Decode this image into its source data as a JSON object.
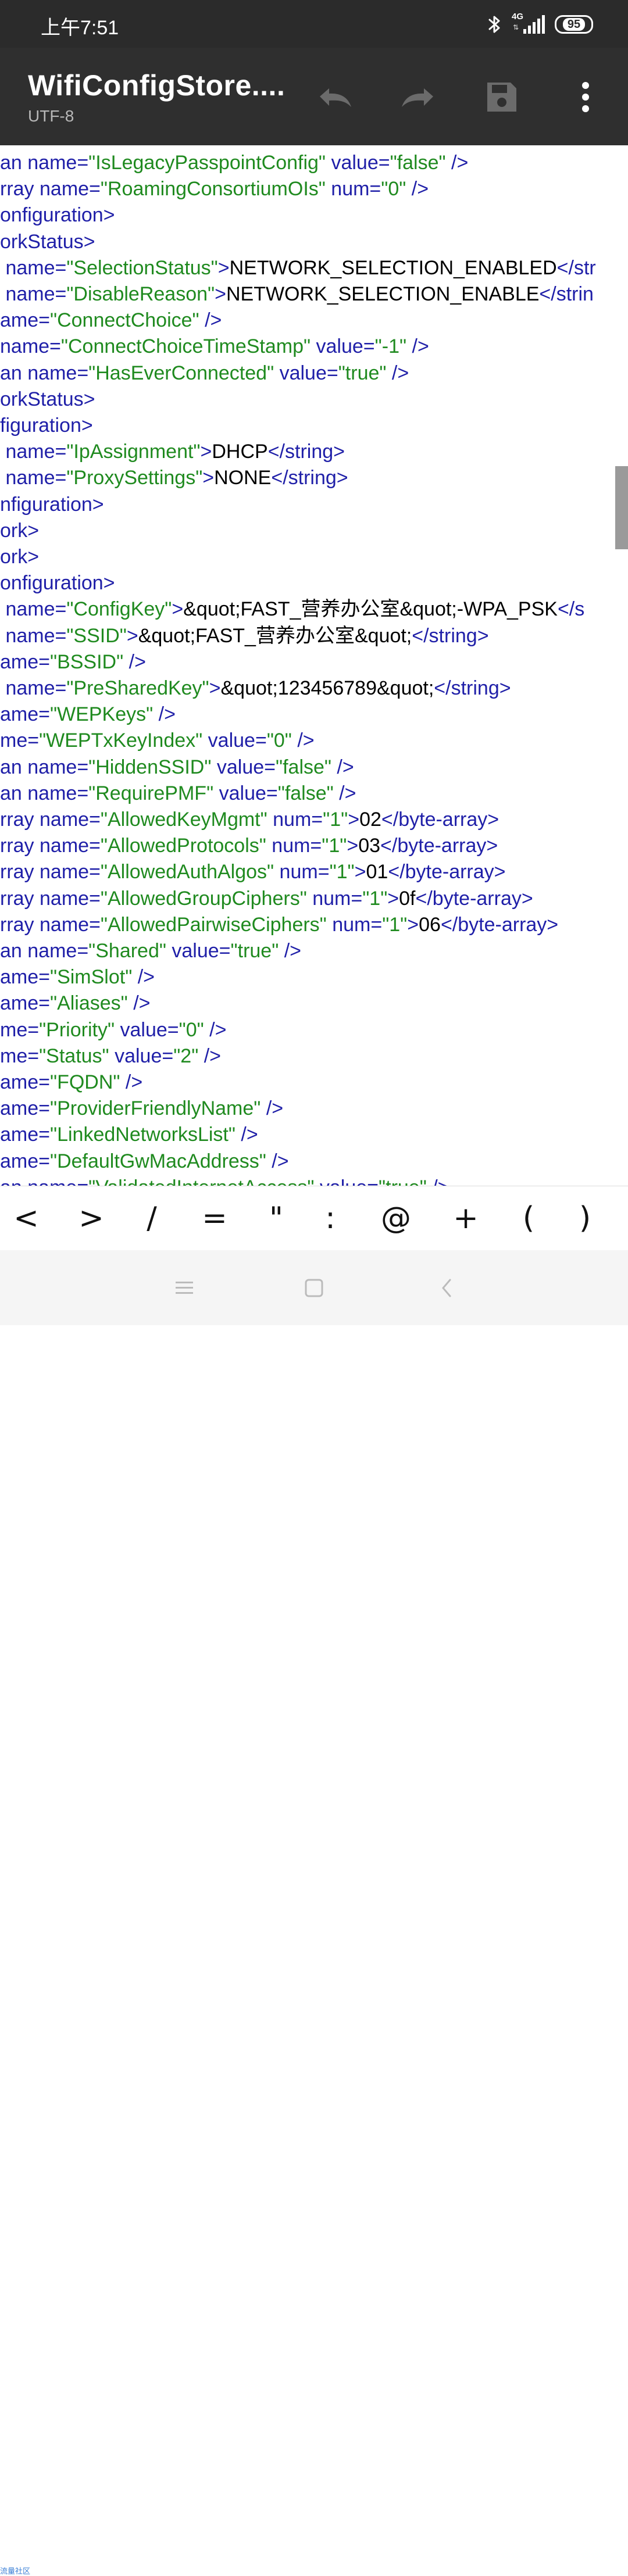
{
  "status_bar": {
    "time": "上午7:51",
    "network_label": "4G",
    "battery": "95",
    "icons": [
      "bluetooth-icon",
      "signal-icon",
      "battery-icon"
    ]
  },
  "app_bar": {
    "title": "WifiConfigStore....",
    "encoding": "UTF-8",
    "actions": [
      "undo-icon",
      "redo-icon",
      "save-icon",
      "more-vert-icon"
    ]
  },
  "colors": {
    "attr": "#1f1fa8",
    "value": "#1f8a1f",
    "text": "#000000",
    "app_bar": "#2f2f2f"
  },
  "editor": {
    "lines": [
      [
        [
          "attr",
          "an name="
        ],
        [
          "val",
          "\"IsLegacyPasspointConfig\""
        ],
        [
          "attr",
          " value="
        ],
        [
          "val",
          "\"false\""
        ],
        [
          "attr",
          " />"
        ]
      ],
      [
        [
          "attr",
          "rray name="
        ],
        [
          "val",
          "\"RoamingConsortiumOIs\""
        ],
        [
          "attr",
          " num="
        ],
        [
          "val",
          "\"0\""
        ],
        [
          "attr",
          " />"
        ]
      ],
      [
        [
          "attr",
          "onfiguration>"
        ]
      ],
      [
        [
          "attr",
          "orkStatus>"
        ]
      ],
      [
        [
          "attr",
          " name="
        ],
        [
          "val",
          "\"SelectionStatus\""
        ],
        [
          "attr",
          ">"
        ],
        [
          "txt",
          "NETWORK_SELECTION_ENABLED"
        ],
        [
          "attr",
          "</str"
        ]
      ],
      [
        [
          "attr",
          " name="
        ],
        [
          "val",
          "\"DisableReason\""
        ],
        [
          "attr",
          ">"
        ],
        [
          "txt",
          "NETWORK_SELECTION_ENABLE"
        ],
        [
          "attr",
          "</strin"
        ]
      ],
      [
        [
          "attr",
          "ame="
        ],
        [
          "val",
          "\"ConnectChoice\""
        ],
        [
          "attr",
          " />"
        ]
      ],
      [
        [
          "attr",
          "name="
        ],
        [
          "val",
          "\"ConnectChoiceTimeStamp\""
        ],
        [
          "attr",
          " value="
        ],
        [
          "val",
          "\"-1\""
        ],
        [
          "attr",
          " />"
        ]
      ],
      [
        [
          "attr",
          "an name="
        ],
        [
          "val",
          "\"HasEverConnected\""
        ],
        [
          "attr",
          " value="
        ],
        [
          "val",
          "\"true\""
        ],
        [
          "attr",
          " />"
        ]
      ],
      [
        [
          "attr",
          "orkStatus>"
        ]
      ],
      [
        [
          "attr",
          "figuration>"
        ]
      ],
      [
        [
          "attr",
          " name="
        ],
        [
          "val",
          "\"IpAssignment\""
        ],
        [
          "attr",
          ">"
        ],
        [
          "txt",
          "DHCP"
        ],
        [
          "attr",
          "</string>"
        ]
      ],
      [
        [
          "attr",
          " name="
        ],
        [
          "val",
          "\"ProxySettings\""
        ],
        [
          "attr",
          ">"
        ],
        [
          "txt",
          "NONE"
        ],
        [
          "attr",
          "</string>"
        ]
      ],
      [
        [
          "attr",
          "nfiguration>"
        ]
      ],
      [
        [
          "attr",
          "ork>"
        ]
      ],
      [
        [
          "attr",
          "ork>"
        ]
      ],
      [
        [
          "attr",
          "onfiguration>"
        ]
      ],
      [
        [
          "attr",
          " name="
        ],
        [
          "val",
          "\"ConfigKey\""
        ],
        [
          "attr",
          ">"
        ],
        [
          "txt",
          "&quot;FAST_营养办公室&quot;-WPA_PSK"
        ],
        [
          "attr",
          "</s"
        ]
      ],
      [
        [
          "attr",
          " name="
        ],
        [
          "val",
          "\"SSID\""
        ],
        [
          "attr",
          ">"
        ],
        [
          "txt",
          "&quot;FAST_营养办公室&quot;"
        ],
        [
          "attr",
          "</string>"
        ]
      ],
      [
        [
          "attr",
          "ame="
        ],
        [
          "val",
          "\"BSSID\""
        ],
        [
          "attr",
          " />"
        ]
      ],
      [
        [
          "attr",
          " name="
        ],
        [
          "val",
          "\"PreSharedKey\""
        ],
        [
          "attr",
          ">"
        ],
        [
          "txt",
          "&quot;123456789&quot;"
        ],
        [
          "attr",
          "</string>"
        ]
      ],
      [
        [
          "attr",
          "ame="
        ],
        [
          "val",
          "\"WEPKeys\""
        ],
        [
          "attr",
          " />"
        ]
      ],
      [
        [
          "attr",
          "me="
        ],
        [
          "val",
          "\"WEPTxKeyIndex\""
        ],
        [
          "attr",
          " value="
        ],
        [
          "val",
          "\"0\""
        ],
        [
          "attr",
          " />"
        ]
      ],
      [
        [
          "attr",
          "an name="
        ],
        [
          "val",
          "\"HiddenSSID\""
        ],
        [
          "attr",
          " value="
        ],
        [
          "val",
          "\"false\""
        ],
        [
          "attr",
          " />"
        ]
      ],
      [
        [
          "attr",
          "an name="
        ],
        [
          "val",
          "\"RequirePMF\""
        ],
        [
          "attr",
          " value="
        ],
        [
          "val",
          "\"false\""
        ],
        [
          "attr",
          " />"
        ]
      ],
      [
        [
          "attr",
          "rray name="
        ],
        [
          "val",
          "\"AllowedKeyMgmt\""
        ],
        [
          "attr",
          " num="
        ],
        [
          "val",
          "\"1\""
        ],
        [
          "attr",
          ">"
        ],
        [
          "txt",
          "02"
        ],
        [
          "attr",
          "</byte-array>"
        ]
      ],
      [
        [
          "attr",
          "rray name="
        ],
        [
          "val",
          "\"AllowedProtocols\""
        ],
        [
          "attr",
          " num="
        ],
        [
          "val",
          "\"1\""
        ],
        [
          "attr",
          ">"
        ],
        [
          "txt",
          "03"
        ],
        [
          "attr",
          "</byte-array>"
        ]
      ],
      [
        [
          "attr",
          "rray name="
        ],
        [
          "val",
          "\"AllowedAuthAlgos\""
        ],
        [
          "attr",
          " num="
        ],
        [
          "val",
          "\"1\""
        ],
        [
          "attr",
          ">"
        ],
        [
          "txt",
          "01"
        ],
        [
          "attr",
          "</byte-array>"
        ]
      ],
      [
        [
          "attr",
          "rray name="
        ],
        [
          "val",
          "\"AllowedGroupCiphers\""
        ],
        [
          "attr",
          " num="
        ],
        [
          "val",
          "\"1\""
        ],
        [
          "attr",
          ">"
        ],
        [
          "txt",
          "0f"
        ],
        [
          "attr",
          "</byte-array>"
        ]
      ],
      [
        [
          "attr",
          "rray name="
        ],
        [
          "val",
          "\"AllowedPairwiseCiphers\""
        ],
        [
          "attr",
          " num="
        ],
        [
          "val",
          "\"1\""
        ],
        [
          "attr",
          ">"
        ],
        [
          "txt",
          "06"
        ],
        [
          "attr",
          "</byte-array>"
        ]
      ],
      [
        [
          "attr",
          "an name="
        ],
        [
          "val",
          "\"Shared\""
        ],
        [
          "attr",
          " value="
        ],
        [
          "val",
          "\"true\""
        ],
        [
          "attr",
          " />"
        ]
      ],
      [
        [
          "attr",
          "ame="
        ],
        [
          "val",
          "\"SimSlot\""
        ],
        [
          "attr",
          " />"
        ]
      ],
      [
        [
          "attr",
          "ame="
        ],
        [
          "val",
          "\"Aliases\""
        ],
        [
          "attr",
          " />"
        ]
      ],
      [
        [
          "attr",
          "me="
        ],
        [
          "val",
          "\"Priority\""
        ],
        [
          "attr",
          " value="
        ],
        [
          "val",
          "\"0\""
        ],
        [
          "attr",
          " />"
        ]
      ],
      [
        [
          "attr",
          "me="
        ],
        [
          "val",
          "\"Status\""
        ],
        [
          "attr",
          " value="
        ],
        [
          "val",
          "\"2\""
        ],
        [
          "attr",
          " />"
        ]
      ],
      [
        [
          "attr",
          "ame="
        ],
        [
          "val",
          "\"FQDN\""
        ],
        [
          "attr",
          " />"
        ]
      ],
      [
        [
          "attr",
          "ame="
        ],
        [
          "val",
          "\"ProviderFriendlyName\""
        ],
        [
          "attr",
          " />"
        ]
      ],
      [
        [
          "attr",
          "ame="
        ],
        [
          "val",
          "\"LinkedNetworksList\""
        ],
        [
          "attr",
          " />"
        ]
      ],
      [
        [
          "attr",
          "ame="
        ],
        [
          "val",
          "\"DefaultGwMacAddress\""
        ],
        [
          "attr",
          " />"
        ]
      ],
      [
        [
          "attr",
          "an name="
        ],
        [
          "val",
          "\"ValidatedInternetAccess\""
        ],
        [
          "attr",
          " value="
        ],
        [
          "val",
          "\"true\""
        ],
        [
          "attr",
          " />"
        ]
      ]
    ]
  },
  "symbol_bar": {
    "keys": [
      "<",
      ">",
      "/",
      "=",
      "\"",
      ":",
      "@",
      "+",
      "(",
      ")"
    ]
  },
  "nav_bar": {
    "buttons": [
      "menu-icon",
      "home-icon",
      "back-icon"
    ]
  },
  "watermark": "流量社区"
}
